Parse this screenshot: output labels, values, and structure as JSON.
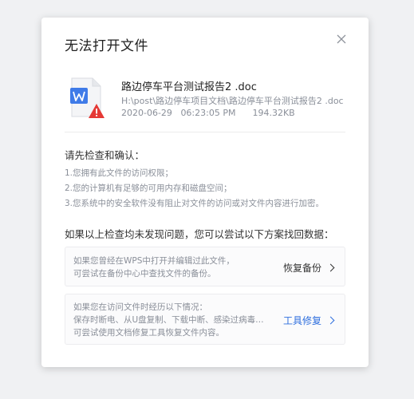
{
  "dialog": {
    "title": "无法打开文件",
    "close_icon": "close-icon"
  },
  "file": {
    "name": "路边停车平台测试报告2 .doc",
    "path": "H:\\post\\路边停车项目文档\\路边停车平台测试报告2 .doc",
    "date": "2020-06-29",
    "time": "06:23:05 PM",
    "size": "194.32KB",
    "icon": "word-document-warning-icon"
  },
  "check": {
    "heading": "请先检查和确认：",
    "items": [
      "1.您拥有此文件的访问权限；",
      "2.您的计算机有足够的可用内存和磁盘空间；",
      "3.您系统中的安全软件没有阻止对文件的访问或对文件内容进行加密。"
    ]
  },
  "recover": {
    "heading": "如果以上检查均未发现问题，您可以尝试以下方案找回数据：",
    "backup": {
      "lines": [
        "如果您曾经在WPS中打开并编辑过此文件，",
        "可尝试在备份中心中查找文件的备份。"
      ],
      "action": "恢复备份"
    },
    "repair": {
      "lines": [
        "如果您在访问文件时经历以下情况：",
        "保存时断电、从U盘复制、下载中断、感染过病毒…",
        "可尝试使用文档修复工具恢复文件内容。"
      ],
      "action": "工具修复",
      "action_color": "#2f6fde"
    }
  }
}
